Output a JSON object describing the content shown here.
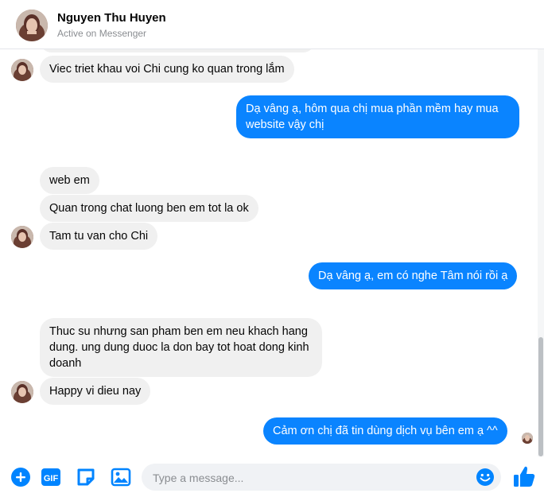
{
  "header": {
    "name": "Nguyen Thu Huyen",
    "status": "Active on Messenger"
  },
  "messages": [
    {
      "dir": "in",
      "text": "Viec triet khau voi Chi cung ko quan trong lắm"
    },
    {
      "dir": "out",
      "text": "Dạ vâng ạ, hôm qua chị mua phần mềm hay mua website vậy chị"
    },
    {
      "dir": "in",
      "text": "web em"
    },
    {
      "dir": "in",
      "text": "Quan trong chat luong ben em tot la ok"
    },
    {
      "dir": "in",
      "text": "Tam tu van cho Chi"
    },
    {
      "dir": "out",
      "text": "Dạ vâng ạ, em có nghe Tâm nói rồi ạ"
    },
    {
      "dir": "in",
      "text": "Thuc su nhưng san pham ben em neu khach hang dung. ung dung duoc la don bay tot hoat dong kinh doanh"
    },
    {
      "dir": "in",
      "text": "Happy vi dieu nay"
    },
    {
      "dir": "out",
      "text": "Cảm ơn chị đã tin dùng dịch vụ bên em ạ ^^"
    }
  ],
  "composer": {
    "placeholder": "Type a message...",
    "gif_label": "GIF"
  },
  "colors": {
    "accent": "#0a84ff",
    "incoming_bubble": "#f0f0f0",
    "icon_blue": "#0084ff",
    "emoji_yellow": "#0084ff"
  }
}
